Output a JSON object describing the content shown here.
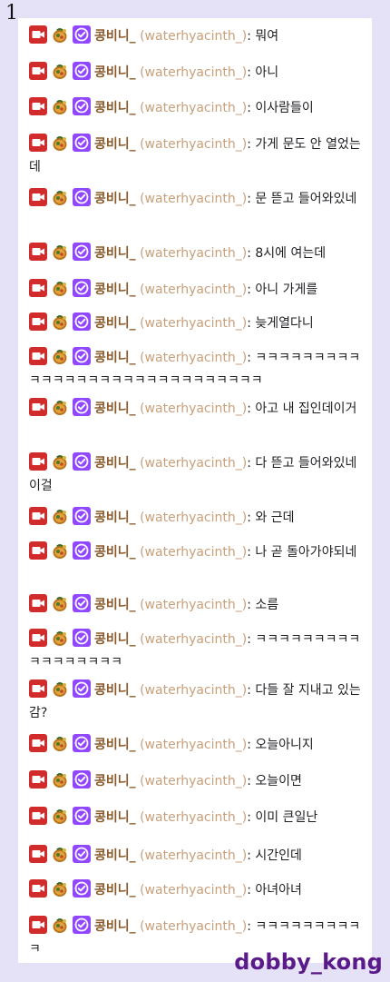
{
  "page_number": "1",
  "watermark": "dobby_kong",
  "chat": {
    "messages": [
      {
        "user": "콩비니_",
        "login": "(waterhyacinth_)",
        "sep": ":",
        "text": "뭐여"
      },
      {
        "user": "콩비니_",
        "login": "(waterhyacinth_)",
        "sep": ":",
        "text": "아니"
      },
      {
        "user": "콩비니_",
        "login": "(waterhyacinth_)",
        "sep": ":",
        "text": "이사람들이"
      },
      {
        "user": "콩비니_",
        "login": "(waterhyacinth_)",
        "sep": ":",
        "text": "가게 문도 안 열었는데"
      },
      {
        "user": "콩비니_",
        "login": "(waterhyacinth_)",
        "sep": ":",
        "text": "문 뜯고 들어와있네"
      },
      {
        "user": "콩비니_",
        "login": "(waterhyacinth_)",
        "sep": ":",
        "text": "8시에 여는데"
      },
      {
        "user": "콩비니_",
        "login": "(waterhyacinth_)",
        "sep": ":",
        "text": "아니 가게를"
      },
      {
        "user": "콩비니_",
        "login": "(waterhyacinth_)",
        "sep": ":",
        "text": "늦게열다니"
      },
      {
        "user": "콩비니_",
        "login": "(waterhyacinth_)",
        "sep": ":",
        "text": "ㅋㅋㅋㅋㅋㅋㅋㅋㅋㅋㅋㅋㅋㅋㅋㅋㅋㅋㅋㅋㅋㅋㅋㅋㅋㅋㅋㅋㅋ"
      },
      {
        "user": "콩비니_",
        "login": "(waterhyacinth_)",
        "sep": ":",
        "text": "아고 내 집인데이거"
      },
      {
        "user": "콩비니_",
        "login": "(waterhyacinth_)",
        "sep": ":",
        "text": "다 뜯고 들어와있네 이걸"
      },
      {
        "user": "콩비니_",
        "login": "(waterhyacinth_)",
        "sep": ":",
        "text": "와 근데"
      },
      {
        "user": "콩비니_",
        "login": "(waterhyacinth_)",
        "sep": ":",
        "text": "나 곧 돌아가야되네"
      },
      {
        "user": "콩비니_",
        "login": "(waterhyacinth_)",
        "sep": ":",
        "text": "소름"
      },
      {
        "user": "콩비니_",
        "login": "(waterhyacinth_)",
        "sep": ":",
        "text": "ㅋㅋㅋㅋㅋㅋㅋㅋㅋㅋㅋㅋㅋㅋㅋㅋㅋ"
      },
      {
        "user": "콩비니_",
        "login": "(waterhyacinth_)",
        "sep": ":",
        "text": "다들 잘 지내고 있는감?"
      },
      {
        "user": "콩비니_",
        "login": "(waterhyacinth_)",
        "sep": ":",
        "text": "오늘아니지"
      },
      {
        "user": "콩비니_",
        "login": "(waterhyacinth_)",
        "sep": ":",
        "text": "오늘이면"
      },
      {
        "user": "콩비니_",
        "login": "(waterhyacinth_)",
        "sep": ":",
        "text": "이미 큰일난"
      },
      {
        "user": "콩비니_",
        "login": "(waterhyacinth_)",
        "sep": ":",
        "text": "시간인데"
      },
      {
        "user": "콩비니_",
        "login": "(waterhyacinth_)",
        "sep": ":",
        "text": "아녀아녀"
      },
      {
        "user": "콩비니_",
        "login": "(waterhyacinth_)",
        "sep": ":",
        "text": "ㅋㅋㅋㅋㅋㅋㅋㅋㅋㅋ"
      }
    ]
  },
  "badges": [
    "video-camera-icon",
    "coin-pouch-icon",
    "verified-check-icon"
  ],
  "colors": {
    "background": "#e5e2f8",
    "panel": "#ffffff",
    "username": "#8b5a2b",
    "login": "#c8a07a",
    "message_text": "#1f1f23",
    "camera_badge": "#d12b2b",
    "verified_badge": "#9146ff",
    "watermark": "#5a1a8a"
  }
}
